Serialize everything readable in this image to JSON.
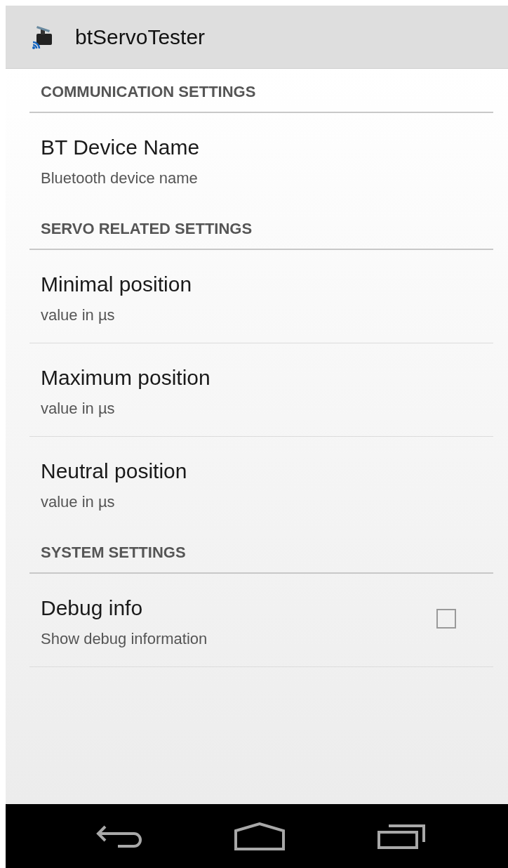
{
  "app_bar": {
    "title": "btServoTester"
  },
  "sections": [
    {
      "title": "COMMUNICATION SETTINGS",
      "items": [
        {
          "kind": "plain",
          "title": "BT Device Name",
          "summary": "Bluetooth device name"
        }
      ]
    },
    {
      "title": "SERVO RELATED SETTINGS",
      "items": [
        {
          "kind": "plain",
          "title": "Minimal position",
          "summary": "value in µs"
        },
        {
          "kind": "plain",
          "title": "Maximum position",
          "summary": "value in µs"
        },
        {
          "kind": "plain",
          "title": "Neutral position",
          "summary": "value in µs"
        }
      ]
    },
    {
      "title": "SYSTEM SETTINGS",
      "items": [
        {
          "kind": "checkbox",
          "title": "Debug info",
          "summary": "Show debug information",
          "checked": false
        }
      ]
    }
  ]
}
